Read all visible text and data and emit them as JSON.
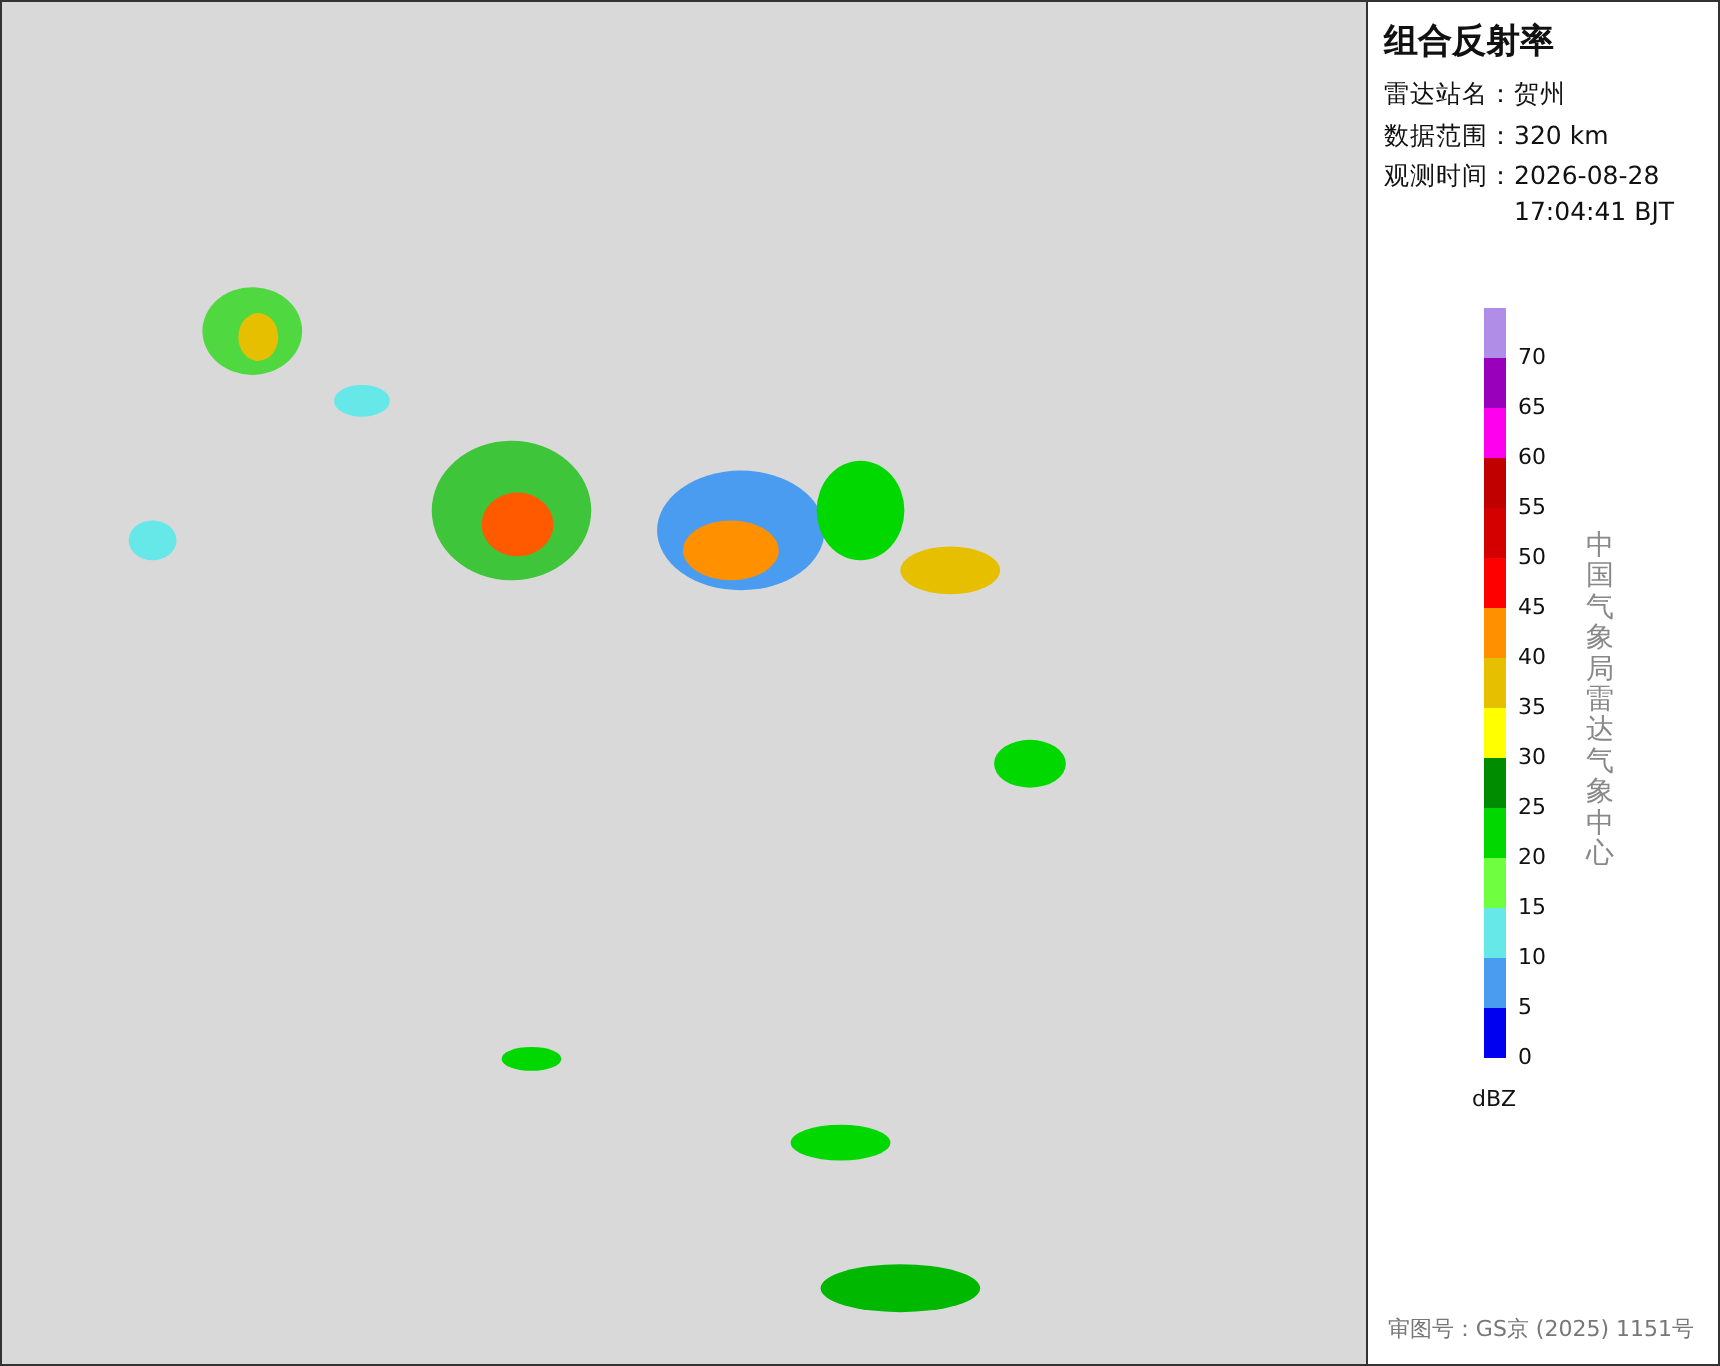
{
  "panel": {
    "title": "组合反射率",
    "info": [
      {
        "label": "雷达站名：",
        "value": "贺州"
      },
      {
        "label": "数据范围：",
        "value": "320 km"
      },
      {
        "label": "观测时间：",
        "value": "2026-08-28 17:04:41 BJT"
      }
    ]
  },
  "legend": {
    "unit": "dBZ",
    "credit": "中国气象局雷达气象中心",
    "items": [
      {
        "label": "70",
        "color": "#b08ee8"
      },
      {
        "label": "65",
        "color": "#9900bb"
      },
      {
        "label": "60",
        "color": "#ff00ee"
      },
      {
        "label": "55",
        "color": "#c00000"
      },
      {
        "label": "50",
        "color": "#d40000"
      },
      {
        "label": "45",
        "color": "#ff0000"
      },
      {
        "label": "40",
        "color": "#ff9000"
      },
      {
        "label": "35",
        "color": "#e6c000"
      },
      {
        "label": "30",
        "color": "#ffff00"
      },
      {
        "label": "25",
        "color": "#008c00"
      },
      {
        "label": "20",
        "color": "#00d800"
      },
      {
        "label": "15",
        "color": "#70ff40"
      },
      {
        "label": "10",
        "color": "#66e8e8"
      },
      {
        "label": "5",
        "color": "#4a9cf0"
      },
      {
        "label": "0",
        "color": "#0000f0"
      }
    ]
  },
  "footer": "审图号：GS京 (2025) 1151号"
}
